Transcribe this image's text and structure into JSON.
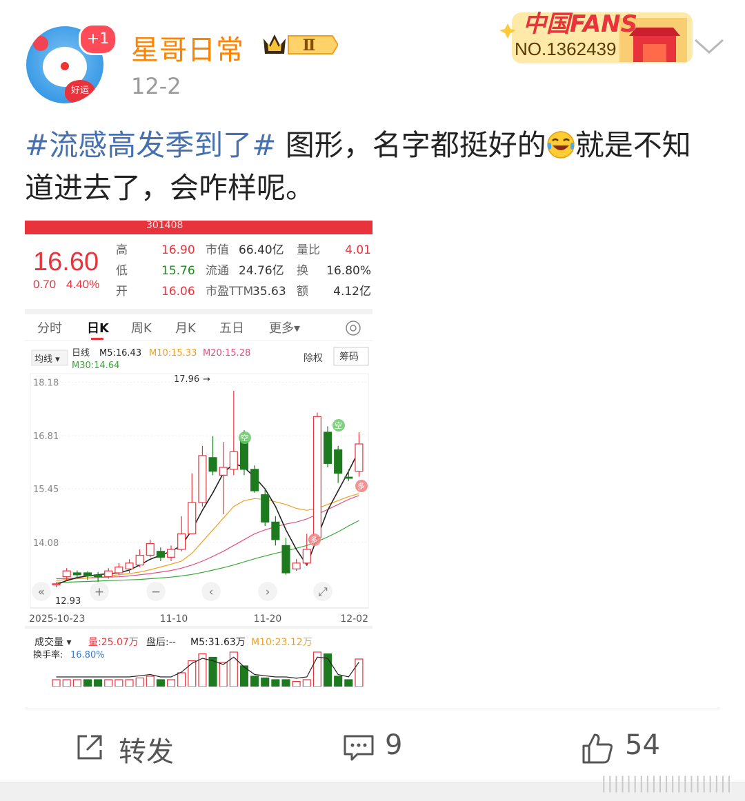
{
  "post": {
    "author": "星哥日常",
    "author_level": "Ⅱ",
    "avatar_badge": "+1",
    "avatar_text": "好运",
    "date": "12-2",
    "fans_badge": {
      "brand": "中国FANS",
      "number": "NO.1362439"
    },
    "hashtag": "#流感高发季到了#",
    "text_before_emoji": " 图形，名字都挺好的",
    "emoji": "laugh-cry-emoji",
    "text_after_emoji": "就是不知道进去了，会咋样呢。"
  },
  "stock": {
    "code_header": "301408",
    "price": "16.60",
    "change": "0.70",
    "change_pct": "4.40%",
    "quote_rows": [
      {
        "l1": "高",
        "v1": "16.90",
        "l2": "市值",
        "v2": "66.40亿",
        "l3": "量比",
        "v3": "4.01"
      },
      {
        "l1": "低",
        "v1": "15.76",
        "l2": "流通",
        "v2": "24.76亿",
        "l3": "换",
        "v3": "16.80%"
      },
      {
        "l1": "开",
        "v1": "16.06",
        "l2": "市盈TTM",
        "v2": "35.63",
        "l3": "额",
        "v3": "4.12亿"
      }
    ],
    "tabs": [
      "分时",
      "日K",
      "周K",
      "月K",
      "五日",
      "更多▾"
    ],
    "active_tab": "日K",
    "ma_selector": "均线 ▾",
    "ma_line1": {
      "label": "日线",
      "m5": "M5:16.43",
      "m10": "M10:15.33",
      "m20": "M20:15.28"
    },
    "ma_line2": "M30:14.64",
    "btn_chuquan": "除权",
    "btn_chouma": "筹码",
    "high_label": "17.96",
    "low_label": "12.93",
    "vol_selector": "成交量 ▾",
    "vol_line": {
      "vol": "量:25.07万",
      "after": "盘后:--",
      "m5": "M5:31.63万",
      "m10": "M10:23.12万"
    },
    "turnover_label": "换手率:",
    "turnover_value": "16.80%",
    "nav_icons": [
      "«",
      "+",
      "−",
      "‹",
      "›",
      "⤢"
    ],
    "tag_kong": "空",
    "tag_duo": "多",
    "colors": {
      "up": "#e8333c",
      "down": "#1e7a1e",
      "ma5": "#222222",
      "ma10": "#f0a020",
      "ma20": "#e05080",
      "ma30": "#3aa83a"
    }
  },
  "chart_data": {
    "type": "candlestick",
    "ylim": [
      12.4,
      18.4
    ],
    "y_ticks": [
      18.18,
      16.81,
      15.45,
      14.08
    ],
    "x_ticks": [
      "2025-10-23",
      "11-10",
      "11-20",
      "12-02"
    ],
    "candles": [
      {
        "o": 13.0,
        "c": 13.02,
        "h": 13.05,
        "l": 12.93
      },
      {
        "o": 13.2,
        "c": 13.35,
        "h": 13.42,
        "l": 13.1
      },
      {
        "o": 13.3,
        "c": 13.25,
        "h": 13.36,
        "l": 13.15
      },
      {
        "o": 13.3,
        "c": 13.22,
        "h": 13.34,
        "l": 13.12
      },
      {
        "o": 13.25,
        "c": 13.2,
        "h": 13.32,
        "l": 13.05
      },
      {
        "o": 13.2,
        "c": 13.35,
        "h": 13.42,
        "l": 13.15
      },
      {
        "o": 13.3,
        "c": 13.45,
        "h": 13.55,
        "l": 13.25
      },
      {
        "o": 13.4,
        "c": 13.55,
        "h": 13.65,
        "l": 13.3
      },
      {
        "o": 13.5,
        "c": 13.75,
        "h": 13.9,
        "l": 13.45
      },
      {
        "o": 13.75,
        "c": 14.05,
        "h": 14.15,
        "l": 13.7
      },
      {
        "o": 13.85,
        "c": 13.7,
        "h": 13.95,
        "l": 13.6
      },
      {
        "o": 13.7,
        "c": 13.9,
        "h": 14.0,
        "l": 13.6
      },
      {
        "o": 13.9,
        "c": 14.3,
        "h": 14.75,
        "l": 13.85
      },
      {
        "o": 14.3,
        "c": 15.1,
        "h": 15.85,
        "l": 14.3
      },
      {
        "o": 15.1,
        "c": 16.3,
        "h": 16.55,
        "l": 15.0
      },
      {
        "o": 16.25,
        "c": 15.9,
        "h": 16.8,
        "l": 15.8
      },
      {
        "o": 15.8,
        "c": 16.0,
        "h": 16.65,
        "l": 14.8
      },
      {
        "o": 15.95,
        "c": 16.4,
        "h": 17.96,
        "l": 15.8
      },
      {
        "o": 16.7,
        "c": 15.95,
        "h": 16.95,
        "l": 15.8
      },
      {
        "o": 15.95,
        "c": 15.4,
        "h": 16.05,
        "l": 15.35
      },
      {
        "o": 15.3,
        "c": 14.6,
        "h": 15.45,
        "l": 14.5
      },
      {
        "o": 14.6,
        "c": 14.15,
        "h": 14.75,
        "l": 14.0
      },
      {
        "o": 14.0,
        "c": 13.3,
        "h": 14.2,
        "l": 13.25
      },
      {
        "o": 13.4,
        "c": 13.55,
        "h": 13.65,
        "l": 13.35
      },
      {
        "o": 13.55,
        "c": 13.9,
        "h": 14.3,
        "l": 13.5
      },
      {
        "o": 14.2,
        "c": 17.3,
        "h": 17.4,
        "l": 14.2
      },
      {
        "o": 16.9,
        "c": 16.1,
        "h": 17.05,
        "l": 16.0
      },
      {
        "o": 16.45,
        "c": 15.85,
        "h": 16.55,
        "l": 15.6
      },
      {
        "o": 15.75,
        "c": 15.72,
        "h": 15.95,
        "l": 15.65
      },
      {
        "o": 15.9,
        "c": 16.6,
        "h": 16.9,
        "l": 15.76
      }
    ],
    "ma5": [
      13.0,
      13.1,
      13.18,
      13.22,
      13.25,
      13.28,
      13.3,
      13.37,
      13.5,
      13.65,
      13.75,
      13.85,
      14.0,
      14.4,
      14.9,
      15.35,
      15.85,
      16.1,
      16.0,
      15.75,
      15.45,
      15.0,
      14.4,
      13.9,
      13.5,
      14.2,
      14.9,
      15.4,
      15.9,
      16.43
    ],
    "ma10": [
      13.1,
      13.13,
      13.15,
      13.17,
      13.2,
      13.22,
      13.25,
      13.28,
      13.32,
      13.38,
      13.45,
      13.52,
      13.6,
      13.8,
      14.1,
      14.4,
      14.7,
      15.0,
      15.15,
      15.2,
      15.18,
      15.12,
      15.05,
      14.95,
      14.9,
      14.95,
      15.05,
      15.15,
      15.25,
      15.33
    ],
    "ma20": [
      13.15,
      13.15,
      13.16,
      13.17,
      13.18,
      13.19,
      13.2,
      13.22,
      13.25,
      13.28,
      13.32,
      13.36,
      13.42,
      13.5,
      13.6,
      13.72,
      13.85,
      14.0,
      14.15,
      14.3,
      14.4,
      14.48,
      14.55,
      14.6,
      14.68,
      14.8,
      14.92,
      15.05,
      15.18,
      15.28
    ],
    "ma30": [
      13.05,
      13.06,
      13.07,
      13.08,
      13.09,
      13.1,
      13.11,
      13.12,
      13.13,
      13.15,
      13.17,
      13.19,
      13.22,
      13.26,
      13.31,
      13.37,
      13.43,
      13.5,
      13.58,
      13.66,
      13.73,
      13.8,
      13.86,
      13.93,
      14.0,
      14.1,
      14.22,
      14.35,
      14.5,
      14.64
    ],
    "volume_visible": [
      {
        "v": 0.2,
        "up": true
      },
      {
        "v": 0.2,
        "up": true
      },
      {
        "v": 0.2,
        "up": true
      },
      {
        "v": 0.2,
        "up": false
      },
      {
        "v": 0.2,
        "up": false
      },
      {
        "v": 0.2,
        "up": true
      },
      {
        "v": 0.2,
        "up": true
      },
      {
        "v": 0.2,
        "up": true
      },
      {
        "v": 0.25,
        "up": true
      },
      {
        "v": 0.3,
        "up": true
      },
      {
        "v": 0.2,
        "up": false
      },
      {
        "v": 0.2,
        "up": true
      },
      {
        "v": 0.4,
        "up": true
      },
      {
        "v": 0.75,
        "up": true
      },
      {
        "v": 0.95,
        "up": true
      },
      {
        "v": 0.85,
        "up": false
      },
      {
        "v": 0.7,
        "up": true
      },
      {
        "v": 1.0,
        "up": true
      },
      {
        "v": 0.6,
        "up": false
      },
      {
        "v": 0.3,
        "up": false
      },
      {
        "v": 0.25,
        "up": false
      },
      {
        "v": 0.2,
        "up": false
      },
      {
        "v": 0.2,
        "up": false
      },
      {
        "v": 0.15,
        "up": true
      },
      {
        "v": 0.2,
        "up": true
      },
      {
        "v": 1.0,
        "up": true
      },
      {
        "v": 0.95,
        "up": false
      },
      {
        "v": 0.3,
        "up": false
      },
      {
        "v": 0.2,
        "up": false
      },
      {
        "v": 0.8,
        "up": true
      }
    ]
  },
  "actions": {
    "repost_label": "转发",
    "comment_count": "9",
    "like_count": "54"
  },
  "watermark": "|||||||||||||||||||||"
}
